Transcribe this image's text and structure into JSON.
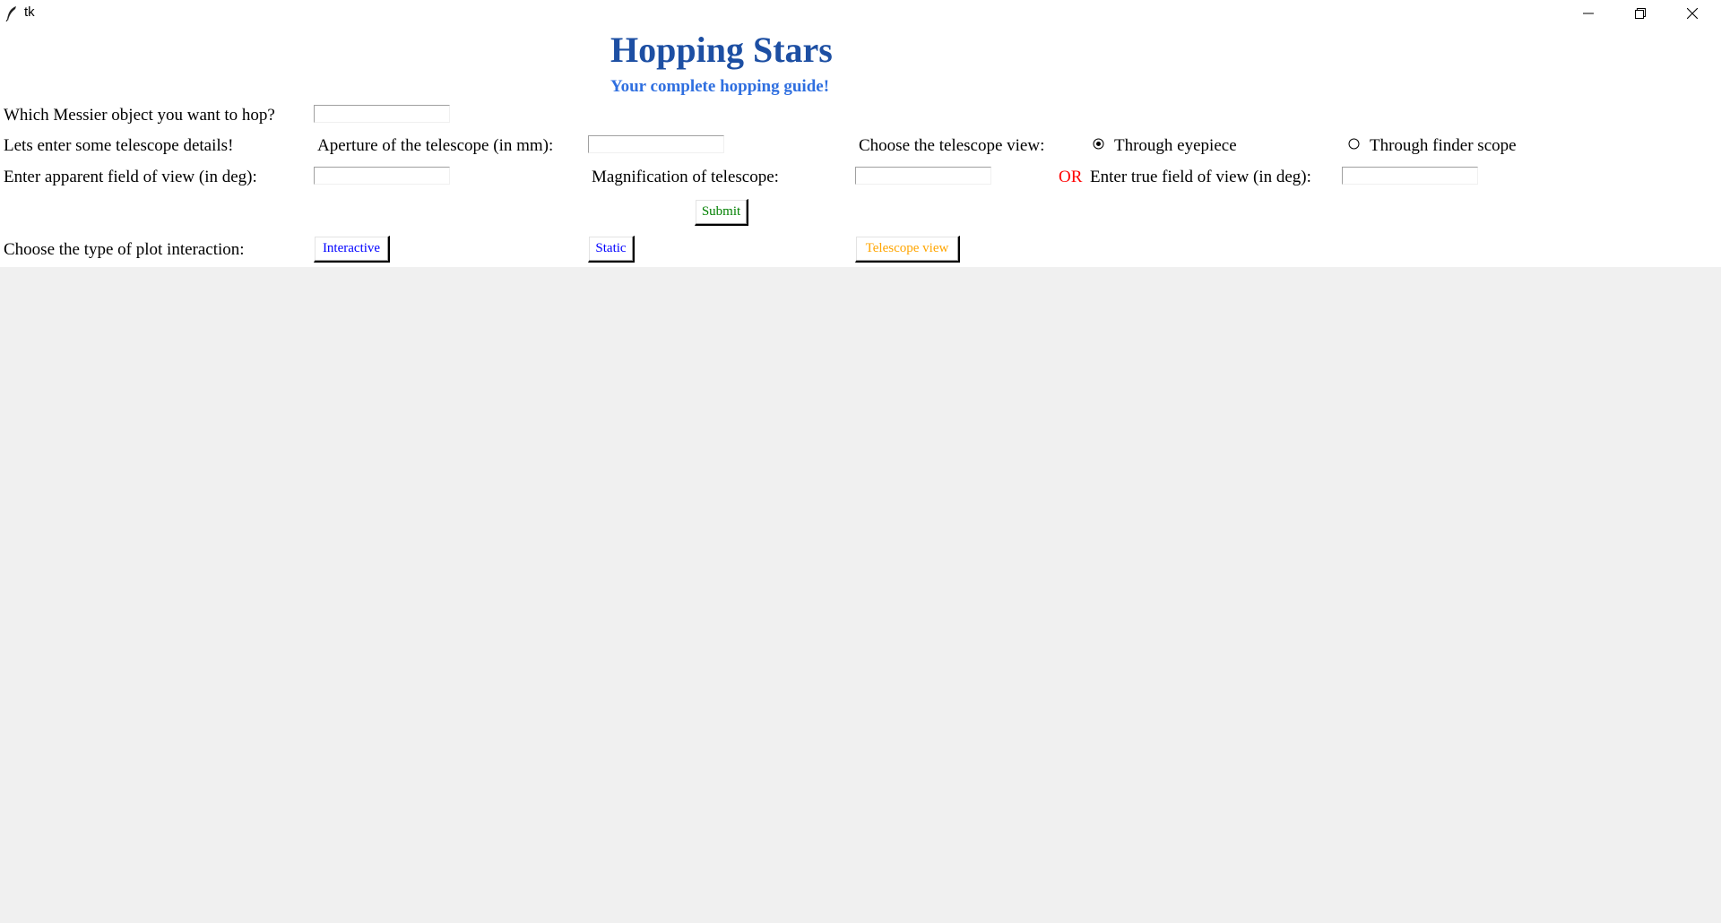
{
  "window": {
    "title": "tk",
    "app_icon": "feather-icon",
    "controls": [
      "minimize-icon",
      "restore-icon",
      "close-icon"
    ]
  },
  "header": {
    "title": "Hopping Stars",
    "subtitle": "Your complete hopping guide!"
  },
  "form": {
    "messier_label": "Which Messier object you want to hop?",
    "messier_value": "",
    "telescope_details_label": "Lets enter some telescope details!",
    "aperture_label": "Aperture of the telescope (in mm):",
    "aperture_value": "",
    "view_label": "Choose the telescope view:",
    "view_options": [
      {
        "label": "Through eyepiece",
        "selected": true
      },
      {
        "label": "Through finder scope",
        "selected": false
      }
    ],
    "apparent_fov_label": "Enter apparent field of view (in deg):",
    "apparent_fov_value": "",
    "magnification_label": "Magnification of telescope:",
    "magnification_value": "",
    "or_label": "OR",
    "true_fov_label": "Enter true field of view (in deg):",
    "true_fov_value": "",
    "submit_label": "Submit"
  },
  "plot": {
    "label": "Choose the type of plot interaction:",
    "buttons": [
      {
        "label": "Interactive",
        "color": "#0000ff"
      },
      {
        "label": "Static",
        "color": "#0000ff"
      },
      {
        "label": "Telescope view",
        "color": "#ffa500"
      }
    ]
  },
  "colors": {
    "title": "#1d4fa3",
    "subtitle": "#2f6fe0",
    "submit_text": "#008000",
    "or_text": "#ff0000",
    "background": "#f0f0f0"
  }
}
